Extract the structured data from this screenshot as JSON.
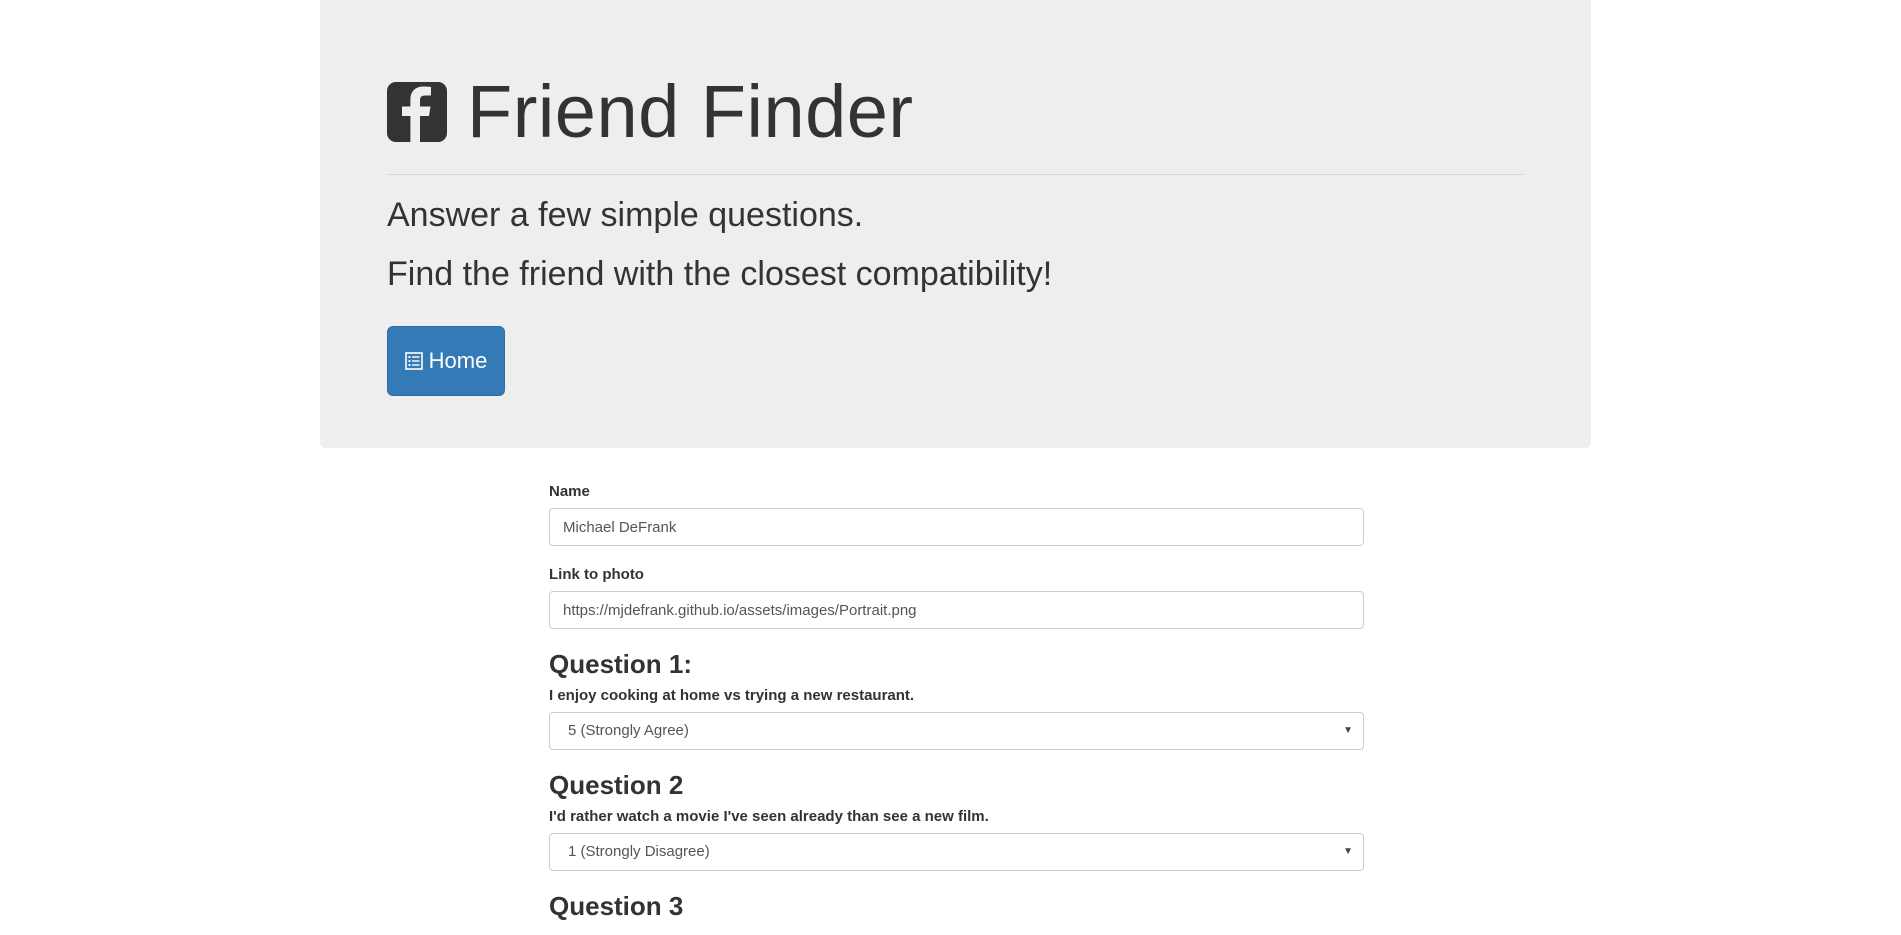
{
  "header": {
    "icon": "facebook-square-icon",
    "title": "Friend Finder",
    "lead_line1": "Answer a few simple questions.",
    "lead_line2": "Find the friend with the closest compatibility!",
    "home_button": {
      "icon": "list-alt-icon",
      "label": "Home"
    }
  },
  "form": {
    "name": {
      "label": "Name",
      "value": "Michael DeFrank"
    },
    "photo": {
      "label": "Link to photo",
      "value": "https://mjdefrank.github.io/assets/images/Portrait.png"
    },
    "questions": [
      {
        "title": "Question 1:",
        "text": "I enjoy cooking at home vs trying a new restaurant.",
        "selected": "5 (Strongly Agree)"
      },
      {
        "title": "Question 2",
        "text": "I'd rather watch a movie I've seen already than see a new film.",
        "selected": "1 (Strongly Disagree)"
      },
      {
        "title": "Question 3"
      }
    ]
  },
  "colors": {
    "jumbotron_bg": "#eeeeee",
    "primary_button": "#337ab7",
    "text": "#333333"
  }
}
